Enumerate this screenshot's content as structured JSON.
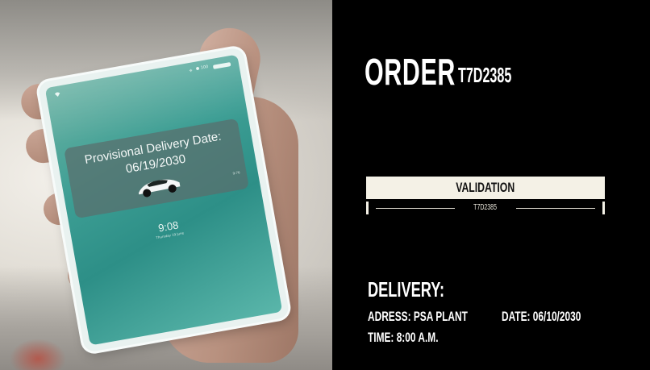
{
  "phone": {
    "status_text": "● 100",
    "notification": {
      "line1": "Provisional Delivery Date:",
      "line2": "06/19/2030",
      "meta": "9:76"
    },
    "lock_time": "9:08",
    "lock_date": "Thursday 19 June"
  },
  "order": {
    "label": "ORDER",
    "number": "T7D2385"
  },
  "validation": {
    "label": "VALIDATION",
    "code": "T7D2385",
    "progress_fraction": 1.0
  },
  "delivery": {
    "title": "DELIVERY:",
    "address": "ADRESS: PSA PLANT",
    "date": "DATE: 06/10/2030",
    "time": "TIME: 8:00 A.M."
  },
  "colors": {
    "panel_bg": "#000000",
    "bar_fill": "#f4f1e6",
    "screen_teal": "#3d9e94"
  },
  "icons": [
    "wifi-icon",
    "location-icon",
    "battery-icon",
    "car-icon"
  ]
}
